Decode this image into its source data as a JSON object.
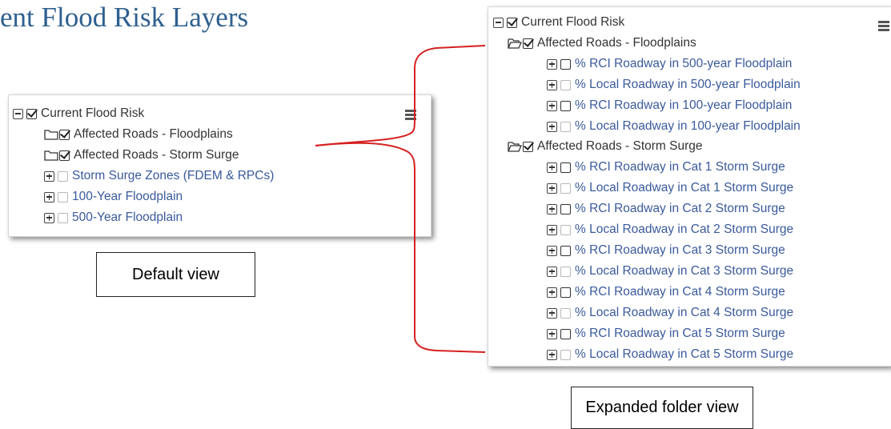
{
  "page_heading": "ent Flood Risk Layers",
  "default_panel": {
    "root": {
      "label": "Current Flood Risk",
      "checked": true,
      "toggle": "minus"
    },
    "folders": [
      {
        "label": "Affected Roads - Floodplains",
        "checked": true,
        "open": false
      },
      {
        "label": "Affected Roads - Storm Surge",
        "checked": true,
        "open": false
      }
    ],
    "layers": [
      {
        "label": "Storm Surge Zones (FDEM & RPCs)",
        "checked": false
      },
      {
        "label": "100-Year Floodplain",
        "checked": false
      },
      {
        "label": "500-Year Floodplain",
        "checked": false
      }
    ],
    "menu_icon": "hamburger-menu-icon"
  },
  "expanded_panel": {
    "root": {
      "label": "Current Flood Risk",
      "checked": true,
      "toggle": "minus"
    },
    "folders": [
      {
        "label": "Affected Roads - Floodplains",
        "checked": true,
        "open": true,
        "layers": [
          {
            "label": "% RCI Roadway in 500-year Floodplain",
            "checked": false
          },
          {
            "label": "% Local Roadway in 500-year Floodplain",
            "checked": false
          },
          {
            "label": "% RCI Roadway in 100-year Floodplain",
            "checked": false
          },
          {
            "label": "% Local Roadway in 100-year Floodplain",
            "checked": false
          }
        ]
      },
      {
        "label": "Affected Roads - Storm Surge",
        "checked": true,
        "open": true,
        "layers": [
          {
            "label": "% RCI Roadway in Cat 1 Storm Surge",
            "checked": false
          },
          {
            "label": "% Local Roadway in Cat 1 Storm Surge",
            "checked": false
          },
          {
            "label": "% RCI Roadway in Cat 2 Storm Surge",
            "checked": false
          },
          {
            "label": "% Local Roadway in Cat 2 Storm Surge",
            "checked": false
          },
          {
            "label": "% RCI Roadway in Cat 3 Storm Surge",
            "checked": false
          },
          {
            "label": "% Local Roadway in Cat 3 Storm Surge",
            "checked": false
          },
          {
            "label": "% RCI Roadway in Cat 4 Storm Surge",
            "checked": false
          },
          {
            "label": "% Local Roadway in Cat 4 Storm Surge",
            "checked": false
          },
          {
            "label": "% RCI Roadway in Cat 5 Storm Surge",
            "checked": false
          },
          {
            "label": "% Local Roadway in Cat 5 Storm Surge",
            "checked": false
          }
        ]
      }
    ],
    "menu_icon": "hamburger-menu-icon"
  },
  "captions": {
    "default_view": "Default view",
    "expanded_view": "Expanded folder view"
  },
  "colors": {
    "heading": "#2e5f8f",
    "layer_link": "#3a5a9c",
    "label_dark": "#333333",
    "bracket": "#d62020"
  }
}
